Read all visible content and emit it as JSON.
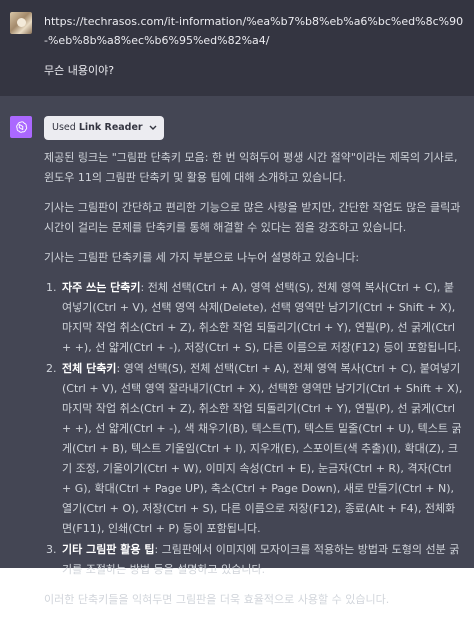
{
  "user": {
    "url": "https://techrasos.com/it-information/%ea%b7%b8%eb%a6%bc%ed%8c%90-%eb%8b%a8%ec%b6%95%ed%82%a4/",
    "question": "무슨 내용이야?"
  },
  "assistant": {
    "plugin_prefix": "Used",
    "plugin_name": "Link Reader",
    "para1": "제공된 링크는 \"그림판 단축키 모음: 한 번 익혀두어 평생 시간 절약\"이라는 제목의 기사로, 윈도우 11의 그림판 단축키 및 활용 팁에 대해 소개하고 있습니다.",
    "para2": "기사는 그림판이 간단하고 편리한 기능으로 많은 사랑을 받지만, 간단한 작업도 많은 클릭과 시간이 걸리는 문제를 단축키를 통해 해결할 수 있다는 점을 강조하고 있습니다.",
    "para3": "기사는 그림판 단축키를 세 가지 부분으로 나누어 설명하고 있습니다:",
    "items": [
      {
        "title": "자주 쓰는 단축키",
        "text": ": 전체 선택(Ctrl + A), 영역 선택(S), 전체 영역 복사(Ctrl + C), 붙여넣기(Ctrl + V), 선택 영역 삭제(Delete), 선택 영역만 남기기(Ctrl + Shift + X), 마지막 작업 취소(Ctrl + Z), 취소한 작업 되돌리기(Ctrl + Y), 연필(P), 선 굵게(Ctrl + +), 선 얇게(Ctrl + -), 저장(Ctrl + S), 다른 이름으로 저장(F12) 등이 포함됩니다."
      },
      {
        "title": "전체 단축키",
        "text": ": 영역 선택(S), 전체 선택(Ctrl + A), 전체 영역 복사(Ctrl + C), 붙여넣기(Ctrl + V), 선택 영역 잘라내기(Ctrl + X), 선택한 영역만 남기기(Ctrl + Shift + X), 마지막 작업 취소(Ctrl + Z), 취소한 작업 되돌리기(Ctrl + Y), 연필(P), 선 굵게(Ctrl + +), 선 얇게(Ctrl + -), 색 채우기(B), 텍스트(T), 텍스트 밑줄(Ctrl + U), 텍스트 굵게(Ctrl + B), 텍스트 기울임(Ctrl + I), 지우개(E), 스포이트(색 추출)(I), 확대(Z), 크기 조정, 기울이기(Ctrl + W), 이미지 속성(Ctrl + E), 눈금자(Ctrl + R), 격자(Ctrl + G), 확대(Ctrl + Page UP), 축소(Ctrl + Page Down), 새로 만들기(Ctrl + N), 열기(Ctrl + O), 저장(Ctrl + S), 다른 이름으로 저장(F12), 종료(Alt + F4), 전체화면(F11), 인쇄(Ctrl + P) 등이 포함됩니다."
      },
      {
        "title": "기타 그림판 활용 팁",
        "text": ": 그림판에서 이미지에 모자이크를 적용하는 방법과 도형의 선분 굵기를 조절하는 방법 등을 설명하고 있습니다."
      }
    ],
    "para4": "이러한 단축키들을 익혀두면 그림판을 더욱 효율적으로 사용할 수 있습니다."
  },
  "colors": {
    "user_bg": "#343541",
    "assistant_bg": "#444654",
    "gpt_avatar": "#ab68ff"
  }
}
